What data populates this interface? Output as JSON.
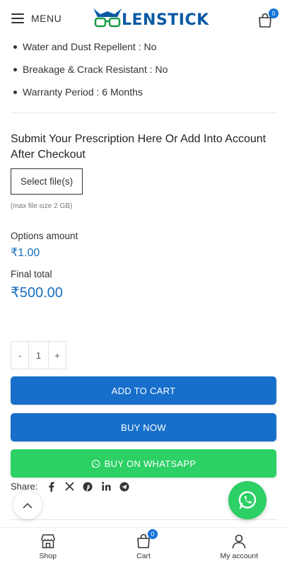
{
  "header": {
    "menu_label": "MENU",
    "logo_text": "LENSTICK",
    "cart_count": "0"
  },
  "specs": [
    "Water and Dust Repellent : No",
    "Breakage & Crack Resistant : No",
    "Warranty Period : 6 Months"
  ],
  "prescription": {
    "title": "Submit Your Prescription Here Or Add Into Account After Checkout",
    "file_button": "Select file(s)",
    "file_note": "(max file size 2 GB)"
  },
  "pricing": {
    "options_label": "Options amount",
    "options_value": "₹1.00",
    "final_label": "Final total",
    "final_value": "₹500.00"
  },
  "quantity": {
    "minus": "-",
    "value": "1",
    "plus": "+"
  },
  "actions": {
    "add_to_cart": "ADD TO CART",
    "buy_now": "BUY NOW",
    "buy_whatsapp": "BUY ON WHATSAPP"
  },
  "share": {
    "label": "Share:",
    "icons": [
      "facebook-icon",
      "x-icon",
      "pinterest-icon",
      "linkedin-icon",
      "telegram-icon"
    ]
  },
  "bottom_nav": {
    "shop": "Shop",
    "cart": "Cart",
    "cart_count": "0",
    "account": "My account"
  },
  "colors": {
    "brand_blue": "#176fcb",
    "price_blue": "#1a6fbd",
    "whatsapp_green": "#2cd065",
    "badge_blue": "#1574d9"
  }
}
